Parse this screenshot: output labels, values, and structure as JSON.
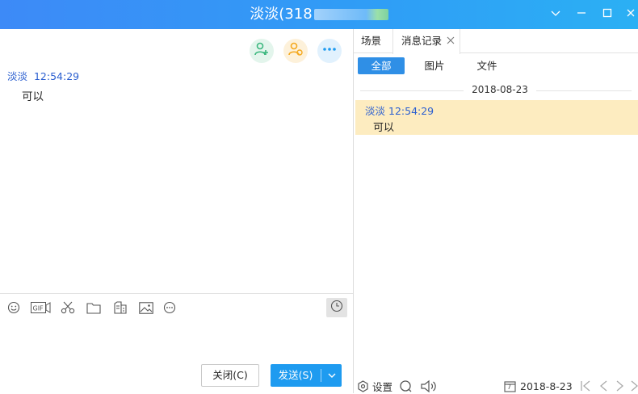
{
  "window": {
    "title": "淡淡(318",
    "controls": [
      "chevron-down-icon",
      "minimize-icon",
      "maximize-icon",
      "close-icon"
    ]
  },
  "chat": {
    "action_buttons": [
      {
        "icon": "add-friend-icon",
        "color": "#3bb77e"
      },
      {
        "icon": "invite-user-icon",
        "color": "#f4a81d"
      },
      {
        "icon": "more-icon",
        "color": "#1e9bf0"
      }
    ],
    "messages": [
      {
        "sender": "淡淡",
        "time": "12:54:29",
        "text": "可以"
      }
    ],
    "toolbar_icons": [
      "emoji-icon",
      "gif-icon",
      "screenshot-scissors-icon",
      "folder-icon",
      "file-send-icon",
      "image-icon",
      "more-circle-icon",
      "history-clock-icon"
    ],
    "close_label": "关闭(C)",
    "send_label": "发送(S)"
  },
  "history": {
    "tabs": [
      {
        "label": "场景",
        "active": false
      },
      {
        "label": "消息记录",
        "active": true,
        "closable": true
      }
    ],
    "filters": [
      {
        "label": "全部",
        "active": true
      },
      {
        "label": "图片",
        "active": false
      },
      {
        "label": "文件",
        "active": false
      }
    ],
    "date": "2018-08-23",
    "entries": [
      {
        "sender": "淡淡",
        "time": "12:54:29",
        "text": "可以"
      }
    ],
    "bottom": {
      "settings_label": "设置",
      "current_date": "2018-8-23",
      "calendar_day": "7"
    }
  },
  "colors": {
    "title_bar": "#2f9ef6",
    "accent": "#1e9bf0",
    "sender_name": "#2b5fd0",
    "highlight_row": "#fdecc0"
  }
}
